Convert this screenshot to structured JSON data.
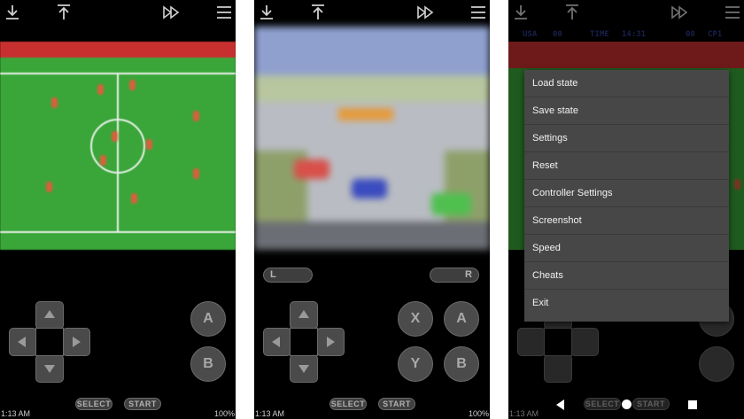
{
  "colors": {
    "pitch_green": "#3aa63a",
    "pitch_stripe": "#c02a2a",
    "menu_bg": "#474747",
    "menu_text": "#f2f2f2",
    "icon_gray": "#d0d0d0"
  },
  "topbar": {
    "icons": [
      "download-icon",
      "upload-icon",
      "fast-forward-icon",
      "hamburger-menu-icon"
    ]
  },
  "phone1": {
    "buttons": {
      "a": "A",
      "b": "B"
    },
    "select_label": "SELECT",
    "start_label": "START",
    "status": {
      "time": "1:13 AM",
      "battery": "100%"
    }
  },
  "phone2": {
    "shoulder": {
      "l": "L",
      "r": "R"
    },
    "buttons": {
      "x": "X",
      "y": "Y",
      "a": "A",
      "b": "B"
    },
    "select_label": "SELECT",
    "start_label": "START",
    "status": {
      "time": "1:13 AM",
      "battery": "100%"
    }
  },
  "phone3": {
    "hud": {
      "team1": "USA",
      "score1": "00",
      "time_label": "TIME",
      "time": "14:31",
      "score2": "00",
      "team2": "CP1"
    },
    "menu": {
      "items": [
        "Load state",
        "Save state",
        "Settings",
        "Reset",
        "Controller Settings",
        "Screenshot",
        "Speed",
        "Cheats",
        "Exit"
      ]
    },
    "select_label": "SELECT",
    "start_label": "START",
    "status": {
      "time": "1:13 AM"
    }
  }
}
